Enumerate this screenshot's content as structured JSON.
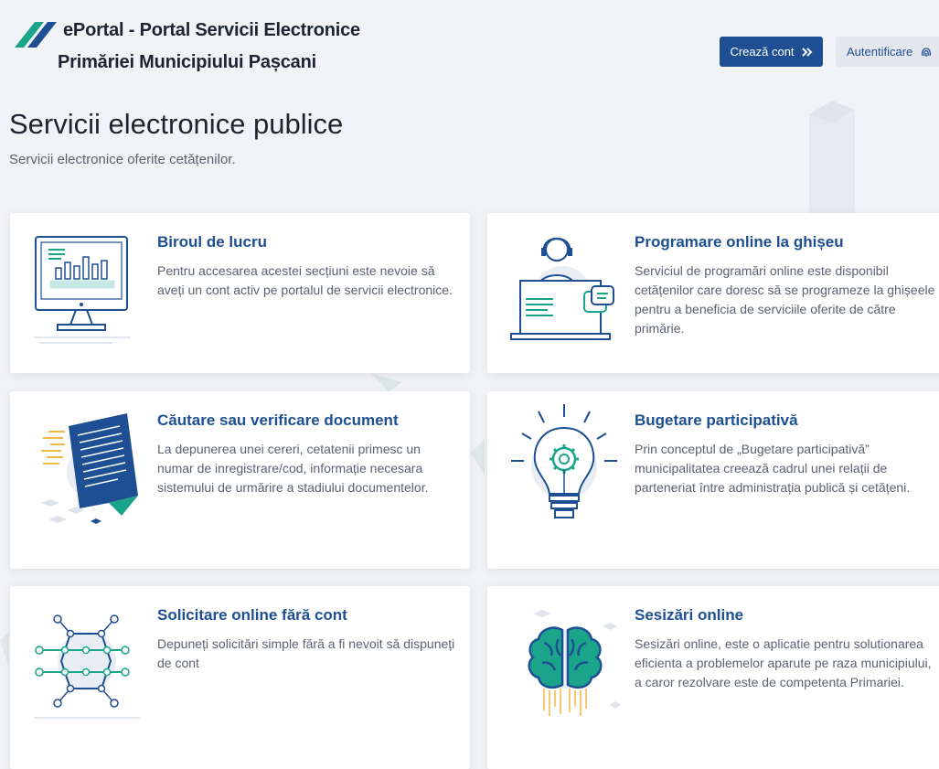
{
  "header": {
    "brand_line1": "ePortal - Portal Servicii Electronice",
    "brand_line2": "Primăriei Municipiului Pașcani",
    "create_account_label": "Crează cont",
    "login_label": "Autentificare"
  },
  "page": {
    "title": "Servicii electronice publice",
    "subtitle": "Servicii electronice oferite cetățenilor."
  },
  "cards": [
    {
      "title": "Biroul de lucru",
      "description": "Pentru accesarea acestei secțiuni este nevoie să aveți un cont activ pe portalul de servicii electronice.",
      "icon": "monitor-chart-icon"
    },
    {
      "title": "Programare online la ghișeu",
      "description": "Serviciul de programări online este disponibil cetățenilor care doresc să se programeze la ghișeele pentru a beneficia de serviciile oferite de către primărie.",
      "icon": "operator-headset-icon"
    },
    {
      "title": "Căutare sau verificare document",
      "description": "La depunerea unei cereri, cetatenii primesc un numar de inregistrare/cod, informație necesara sistemului de urmărire a stadiului documentelor.",
      "icon": "document-icon"
    },
    {
      "title": "Bugetare participativă",
      "description": "Prin conceptul de „Bugetare participativă” municipalitatea creează cadrul unei relații de parteneriat între administrația publică și cetățeni.",
      "icon": "lightbulb-gear-icon"
    },
    {
      "title": "Solicitare online fără cont",
      "description": "Depuneți solicitări simple fără a fi nevoit să dispuneți de cont",
      "icon": "network-nodes-icon"
    },
    {
      "title": "Sesizări online",
      "description": "Sesizări online, este o aplicatie pentru solutionarea eficienta a problemelor aparute pe raza municipiului, a caror rezolvare este de competenta Primariei.",
      "icon": "brain-icon"
    }
  ],
  "colors": {
    "primary": "#1e4f93",
    "accent_green": "#1aa58a",
    "background": "#f1f3f6"
  }
}
